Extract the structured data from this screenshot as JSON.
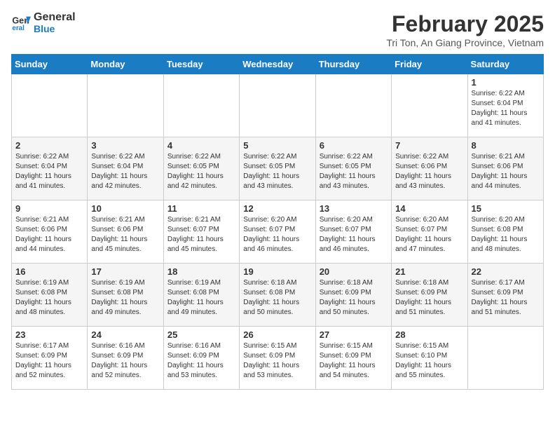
{
  "header": {
    "logo_line1": "General",
    "logo_line2": "Blue",
    "month_title": "February 2025",
    "location": "Tri Ton, An Giang Province, Vietnam"
  },
  "days_of_week": [
    "Sunday",
    "Monday",
    "Tuesday",
    "Wednesday",
    "Thursday",
    "Friday",
    "Saturday"
  ],
  "weeks": [
    [
      {
        "day": "",
        "info": ""
      },
      {
        "day": "",
        "info": ""
      },
      {
        "day": "",
        "info": ""
      },
      {
        "day": "",
        "info": ""
      },
      {
        "day": "",
        "info": ""
      },
      {
        "day": "",
        "info": ""
      },
      {
        "day": "1",
        "info": "Sunrise: 6:22 AM\nSunset: 6:04 PM\nDaylight: 11 hours\nand 41 minutes."
      }
    ],
    [
      {
        "day": "2",
        "info": "Sunrise: 6:22 AM\nSunset: 6:04 PM\nDaylight: 11 hours\nand 41 minutes."
      },
      {
        "day": "3",
        "info": "Sunrise: 6:22 AM\nSunset: 6:04 PM\nDaylight: 11 hours\nand 42 minutes."
      },
      {
        "day": "4",
        "info": "Sunrise: 6:22 AM\nSunset: 6:05 PM\nDaylight: 11 hours\nand 42 minutes."
      },
      {
        "day": "5",
        "info": "Sunrise: 6:22 AM\nSunset: 6:05 PM\nDaylight: 11 hours\nand 43 minutes."
      },
      {
        "day": "6",
        "info": "Sunrise: 6:22 AM\nSunset: 6:05 PM\nDaylight: 11 hours\nand 43 minutes."
      },
      {
        "day": "7",
        "info": "Sunrise: 6:22 AM\nSunset: 6:06 PM\nDaylight: 11 hours\nand 43 minutes."
      },
      {
        "day": "8",
        "info": "Sunrise: 6:21 AM\nSunset: 6:06 PM\nDaylight: 11 hours\nand 44 minutes."
      }
    ],
    [
      {
        "day": "9",
        "info": "Sunrise: 6:21 AM\nSunset: 6:06 PM\nDaylight: 11 hours\nand 44 minutes."
      },
      {
        "day": "10",
        "info": "Sunrise: 6:21 AM\nSunset: 6:06 PM\nDaylight: 11 hours\nand 45 minutes."
      },
      {
        "day": "11",
        "info": "Sunrise: 6:21 AM\nSunset: 6:07 PM\nDaylight: 11 hours\nand 45 minutes."
      },
      {
        "day": "12",
        "info": "Sunrise: 6:20 AM\nSunset: 6:07 PM\nDaylight: 11 hours\nand 46 minutes."
      },
      {
        "day": "13",
        "info": "Sunrise: 6:20 AM\nSunset: 6:07 PM\nDaylight: 11 hours\nand 46 minutes."
      },
      {
        "day": "14",
        "info": "Sunrise: 6:20 AM\nSunset: 6:07 PM\nDaylight: 11 hours\nand 47 minutes."
      },
      {
        "day": "15",
        "info": "Sunrise: 6:20 AM\nSunset: 6:08 PM\nDaylight: 11 hours\nand 48 minutes."
      }
    ],
    [
      {
        "day": "16",
        "info": "Sunrise: 6:19 AM\nSunset: 6:08 PM\nDaylight: 11 hours\nand 48 minutes."
      },
      {
        "day": "17",
        "info": "Sunrise: 6:19 AM\nSunset: 6:08 PM\nDaylight: 11 hours\nand 49 minutes."
      },
      {
        "day": "18",
        "info": "Sunrise: 6:19 AM\nSunset: 6:08 PM\nDaylight: 11 hours\nand 49 minutes."
      },
      {
        "day": "19",
        "info": "Sunrise: 6:18 AM\nSunset: 6:08 PM\nDaylight: 11 hours\nand 50 minutes."
      },
      {
        "day": "20",
        "info": "Sunrise: 6:18 AM\nSunset: 6:09 PM\nDaylight: 11 hours\nand 50 minutes."
      },
      {
        "day": "21",
        "info": "Sunrise: 6:18 AM\nSunset: 6:09 PM\nDaylight: 11 hours\nand 51 minutes."
      },
      {
        "day": "22",
        "info": "Sunrise: 6:17 AM\nSunset: 6:09 PM\nDaylight: 11 hours\nand 51 minutes."
      }
    ],
    [
      {
        "day": "23",
        "info": "Sunrise: 6:17 AM\nSunset: 6:09 PM\nDaylight: 11 hours\nand 52 minutes."
      },
      {
        "day": "24",
        "info": "Sunrise: 6:16 AM\nSunset: 6:09 PM\nDaylight: 11 hours\nand 52 minutes."
      },
      {
        "day": "25",
        "info": "Sunrise: 6:16 AM\nSunset: 6:09 PM\nDaylight: 11 hours\nand 53 minutes."
      },
      {
        "day": "26",
        "info": "Sunrise: 6:15 AM\nSunset: 6:09 PM\nDaylight: 11 hours\nand 53 minutes."
      },
      {
        "day": "27",
        "info": "Sunrise: 6:15 AM\nSunset: 6:09 PM\nDaylight: 11 hours\nand 54 minutes."
      },
      {
        "day": "28",
        "info": "Sunrise: 6:15 AM\nSunset: 6:10 PM\nDaylight: 11 hours\nand 55 minutes."
      },
      {
        "day": "",
        "info": ""
      }
    ]
  ]
}
